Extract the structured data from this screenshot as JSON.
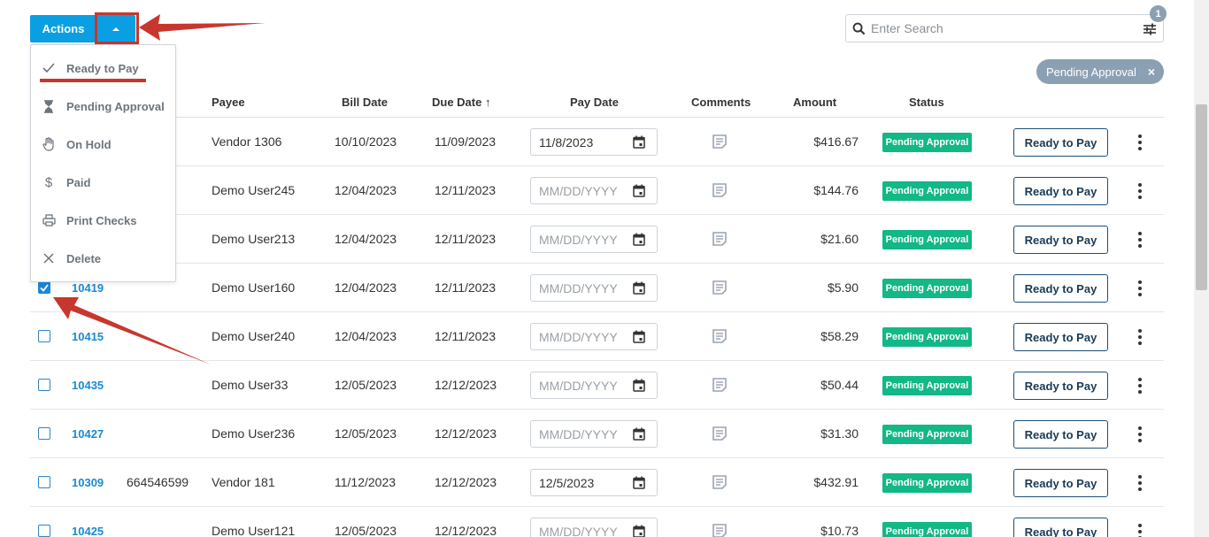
{
  "toolbar": {
    "actions_label": "Actions",
    "accent": "#0a9fe2"
  },
  "search": {
    "placeholder": "Enter Search",
    "filter_count": "1"
  },
  "filter_chip": {
    "label": "Pending Approval",
    "close": "×"
  },
  "columns": {
    "payee": "Payee",
    "bill_date": "Bill Date",
    "due_date": "Due Date ↑",
    "pay_date": "Pay Date",
    "comments": "Comments",
    "amount": "Amount",
    "status": "Status"
  },
  "menu": {
    "items": [
      {
        "label": "Ready to Pay",
        "icon": "check-icon"
      },
      {
        "label": "Pending Approval",
        "icon": "hourglass-icon"
      },
      {
        "label": "On Hold",
        "icon": "hand-icon"
      },
      {
        "label": "Paid",
        "icon": "dollar-icon"
      },
      {
        "label": "Print Checks",
        "icon": "printer-icon"
      },
      {
        "label": "Delete",
        "icon": "close-icon"
      }
    ]
  },
  "rows": [
    {
      "checked": false,
      "bill_no": "",
      "ref": "",
      "payee": "Vendor 1306",
      "bill_date": "10/10/2023",
      "due_date": "11/09/2023",
      "pay_date": "11/8/2023",
      "amount": "$416.67",
      "status": "Pending Approval",
      "action": "Ready to Pay"
    },
    {
      "checked": false,
      "bill_no": "",
      "ref": "",
      "payee": "Demo User245",
      "bill_date": "12/04/2023",
      "due_date": "12/11/2023",
      "pay_date": "",
      "amount": "$144.76",
      "status": "Pending Approval",
      "action": "Ready to Pay"
    },
    {
      "checked": false,
      "bill_no": "",
      "ref": "",
      "payee": "Demo User213",
      "bill_date": "12/04/2023",
      "due_date": "12/11/2023",
      "pay_date": "",
      "amount": "$21.60",
      "status": "Pending Approval",
      "action": "Ready to Pay"
    },
    {
      "checked": true,
      "bill_no": "10419",
      "ref": "",
      "payee": "Demo User160",
      "bill_date": "12/04/2023",
      "due_date": "12/11/2023",
      "pay_date": "",
      "amount": "$5.90",
      "status": "Pending Approval",
      "action": "Ready to Pay"
    },
    {
      "checked": false,
      "bill_no": "10415",
      "ref": "",
      "payee": "Demo User240",
      "bill_date": "12/04/2023",
      "due_date": "12/11/2023",
      "pay_date": "",
      "amount": "$58.29",
      "status": "Pending Approval",
      "action": "Ready to Pay"
    },
    {
      "checked": false,
      "bill_no": "10435",
      "ref": "",
      "payee": "Demo User33",
      "bill_date": "12/05/2023",
      "due_date": "12/12/2023",
      "pay_date": "",
      "amount": "$50.44",
      "status": "Pending Approval",
      "action": "Ready to Pay"
    },
    {
      "checked": false,
      "bill_no": "10427",
      "ref": "",
      "payee": "Demo User236",
      "bill_date": "12/05/2023",
      "due_date": "12/12/2023",
      "pay_date": "",
      "amount": "$31.30",
      "status": "Pending Approval",
      "action": "Ready to Pay"
    },
    {
      "checked": false,
      "bill_no": "10309",
      "ref": "664546599",
      "payee": "Vendor 181",
      "bill_date": "11/12/2023",
      "due_date": "12/12/2023",
      "pay_date": "12/5/2023",
      "amount": "$432.91",
      "status": "Pending Approval",
      "action": "Ready to Pay"
    },
    {
      "checked": false,
      "bill_no": "10425",
      "ref": "",
      "payee": "Demo User121",
      "bill_date": "12/05/2023",
      "due_date": "12/12/2023",
      "pay_date": "",
      "amount": "$10.73",
      "status": "Pending Approval",
      "action": "Ready to Pay"
    }
  ],
  "date_placeholder": "MM/DD/YYYY",
  "colors": {
    "status_badge": "#12b886",
    "link": "#1b8ad3",
    "annotation": "#c8372d",
    "chip": "#8ca0b3"
  }
}
